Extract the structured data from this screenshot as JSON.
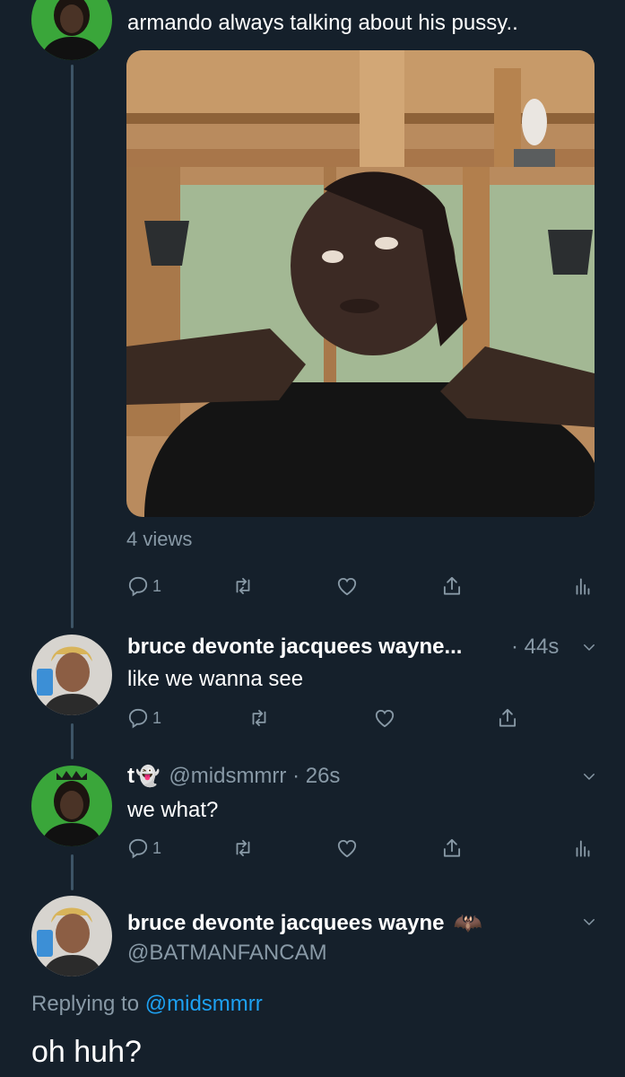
{
  "tweet1": {
    "text": "armando always talking about his pussy..",
    "views": "4 views",
    "reply_count": "1"
  },
  "tweet2": {
    "display_name": "bruce devonte jacquees wayne...",
    "time": "· 44s",
    "text": "like we wanna see",
    "reply_count": "1"
  },
  "tweet3": {
    "display_name": "t",
    "ghost_emoji": "👻",
    "handle_time": "@midsmmrr · 26s",
    "text": "we what?",
    "reply_count": "1"
  },
  "tweet4": {
    "display_name": "bruce devonte jacquees wayne",
    "bat_emoji": "🦇",
    "handle": "@BATMANFANCAM",
    "replying_prefix": "Replying to",
    "replying_handle": "@midsmmrr",
    "text": "oh huh?"
  },
  "icons": {
    "reply": "reply-icon",
    "retweet": "retweet-icon",
    "like": "heart-icon",
    "share": "share-icon",
    "analytics": "analytics-icon",
    "more": "chevron-down-icon"
  },
  "colors": {
    "background": "#15202b",
    "muted": "#8899a6",
    "thread_line": "#3d5466",
    "link": "#1da1f2"
  }
}
